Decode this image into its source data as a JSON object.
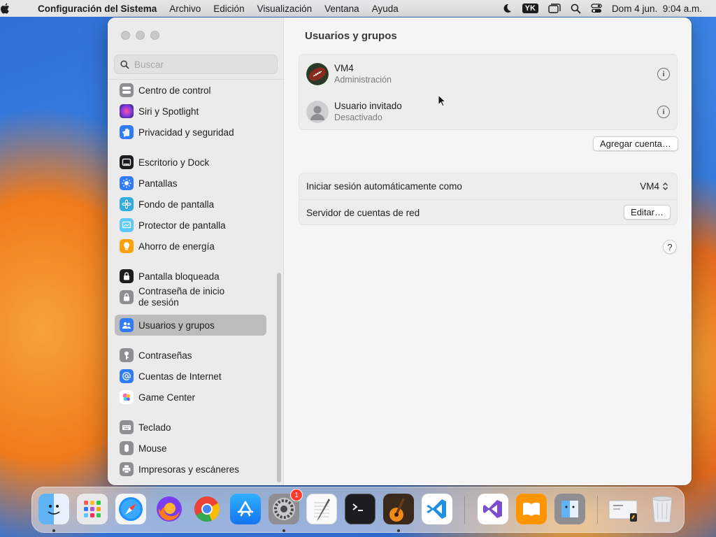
{
  "menubar": {
    "app_name": "Configuración del Sistema",
    "menus": [
      "Archivo",
      "Edición",
      "Visualización",
      "Ventana",
      "Ayuda"
    ],
    "keyboard_badge": "YK",
    "datetime": "Dom 4 jun.  9:04 a.m."
  },
  "sidebar": {
    "search_placeholder": "Buscar",
    "items": [
      {
        "label": "Centro de control",
        "icon": "control-center-icon",
        "color": "#8e8e93"
      },
      {
        "label": "Siri y Spotlight",
        "icon": "siri-icon",
        "color": "#5a2ea6"
      },
      {
        "label": "Privacidad y seguridad",
        "icon": "hand-icon",
        "color": "#2f7cf6"
      },
      {
        "label": "Escritorio y Dock",
        "icon": "dock-icon",
        "color": "#1d1d1f"
      },
      {
        "label": "Pantallas",
        "icon": "sun-icon",
        "color": "#2f7cf6"
      },
      {
        "label": "Fondo de pantalla",
        "icon": "flower-icon",
        "color": "#35aadc"
      },
      {
        "label": "Protector de pantalla",
        "icon": "screensaver-icon",
        "color": "#5ac8fa"
      },
      {
        "label": "Ahorro de energía",
        "icon": "lightbulb-icon",
        "color": "#ff9f0a"
      },
      {
        "label": "Pantalla bloqueada",
        "icon": "lock-icon",
        "color": "#1d1d1f"
      },
      {
        "label_line1": "Contraseña de inicio",
        "label_line2": "de sesión",
        "icon": "lock-icon",
        "color": "#8e8e93"
      },
      {
        "label": "Usuarios y grupos",
        "icon": "users-icon",
        "color": "#2f7cf6"
      },
      {
        "label": "Contraseñas",
        "icon": "key-icon",
        "color": "#8e8e93"
      },
      {
        "label": "Cuentas de Internet",
        "icon": "at-icon",
        "color": "#2f7cf6"
      },
      {
        "label": "Game Center",
        "icon": "game-center-icon",
        "color": "#ffffff"
      },
      {
        "label": "Teclado",
        "icon": "keyboard-icon",
        "color": "#8e8e93"
      },
      {
        "label": "Mouse",
        "icon": "mouse-icon",
        "color": "#8e8e93"
      },
      {
        "label": "Impresoras y escáneres",
        "icon": "printer-icon",
        "color": "#8e8e93"
      }
    ]
  },
  "main": {
    "title": "Usuarios y grupos",
    "users": [
      {
        "name": "VM4",
        "role": "Administración"
      },
      {
        "name": "Usuario invitado",
        "role": "Desactivado"
      }
    ],
    "add_account_label": "Agregar cuenta…",
    "auto_login_label": "Iniciar sesión automáticamente como",
    "auto_login_value": "VM4",
    "network_server_label": "Servidor de cuentas de red",
    "edit_label": "Editar…",
    "help_label": "?"
  },
  "dock": {
    "apps": [
      "Finder",
      "Launchpad",
      "Safari",
      "Firefox",
      "Chrome",
      "App Store",
      "Configuración del Sistema",
      "TextEdit",
      "Terminal",
      "GarageBand",
      "Visual Studio Code",
      "Visual Studio",
      "Libros",
      "Migración",
      "Documento",
      "Papelera"
    ],
    "settings_badge": "1"
  }
}
